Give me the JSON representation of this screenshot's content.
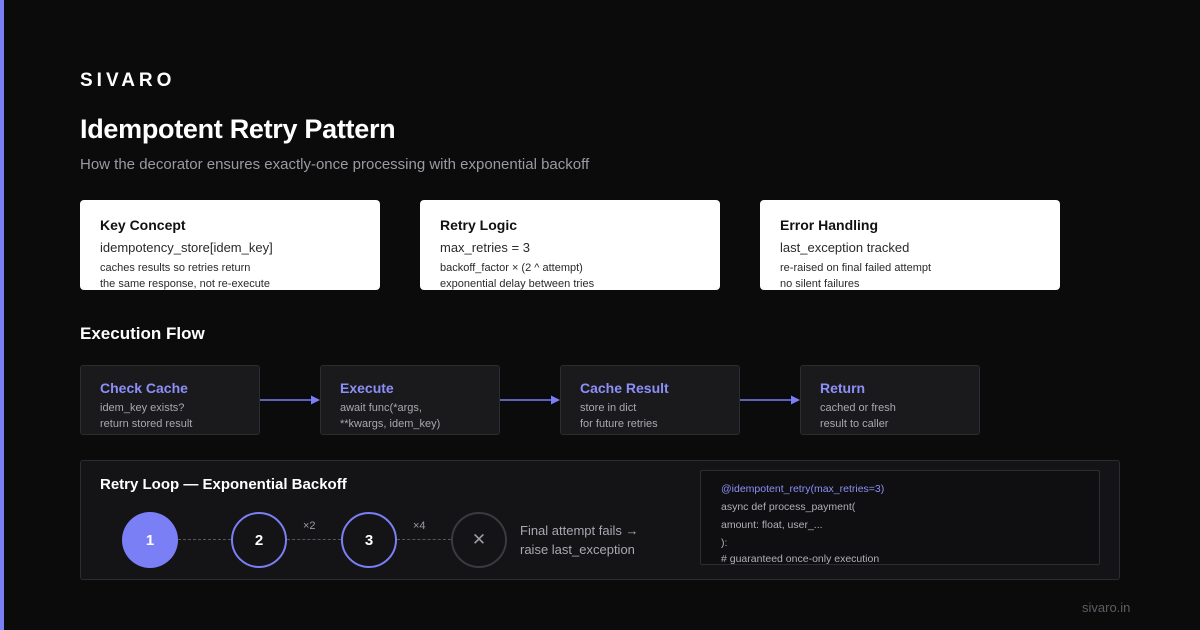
{
  "brand": "SIVARO",
  "title": "Idempotent Retry Pattern",
  "subtitle": "How the decorator ensures exactly-once processing with exponential backoff",
  "accent_color": "#7b7ff5",
  "cards": [
    {
      "title": "Key Concept",
      "code": "idempotency_store[idem_key]",
      "line1": "caches results so retries return",
      "line2": "the same response, not re-execute"
    },
    {
      "title": "Retry Logic",
      "code": "max_retries = 3",
      "line1": "backoff_factor × (2 ^ attempt)",
      "line2": "exponential delay between tries"
    },
    {
      "title": "Error Handling",
      "code": "last_exception tracked",
      "line1": "re-raised on final failed attempt",
      "line2": "no silent failures"
    }
  ],
  "flow": {
    "title": "Execution Flow",
    "steps": [
      {
        "title": "Check Cache",
        "line1": "idem_key exists?",
        "line2": "return stored result"
      },
      {
        "title": "Execute",
        "line1": "await func(*args,",
        "line2": "**kwargs, idem_key)"
      },
      {
        "title": "Cache Result",
        "line1": "store in dict",
        "line2": "for future retries"
      },
      {
        "title": "Return",
        "line1": "cached or fresh",
        "line2": "result to caller"
      }
    ]
  },
  "retry": {
    "title": "Retry Loop — Exponential Backoff",
    "attempts": [
      "1",
      "2",
      "3",
      "✕"
    ],
    "multipliers": [
      "×2",
      "×4"
    ],
    "final_line1": "Final attempt fails →",
    "final_line2": "raise last_exception"
  },
  "code": [
    "@idempotent_retry(max_retries=3)",
    "async def process_payment(",
    "amount: float, user_...",
    "):",
    "# guaranteed once-only execution"
  ],
  "footer": "sivaro.in"
}
